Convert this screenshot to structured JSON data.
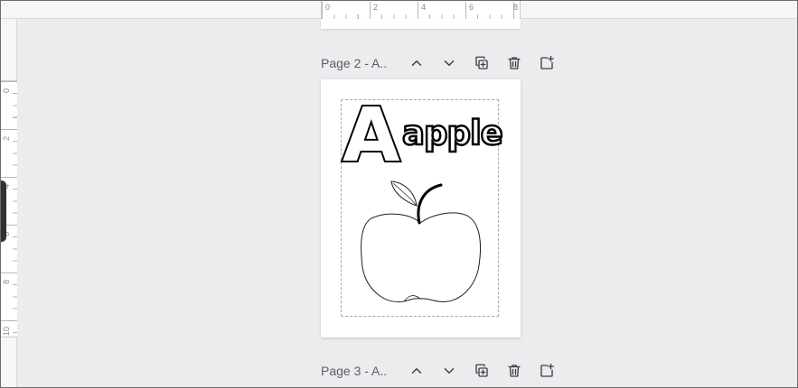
{
  "ruler_top": {
    "ticks": [
      "0",
      "2",
      "4",
      "6",
      "8"
    ]
  },
  "ruler_left": {
    "ticks": [
      "0",
      "2",
      "4",
      "6",
      "8",
      "10"
    ]
  },
  "page2": {
    "label": "Page 2 - A..",
    "content": {
      "letter": "A",
      "word": "apple"
    }
  },
  "page3": {
    "label": "Page 3 - A.."
  },
  "icons": {
    "up": "chevron-up-icon",
    "down": "chevron-down-icon",
    "duplicate": "duplicate-page-icon",
    "delete": "trash-icon",
    "add": "add-page-icon"
  }
}
